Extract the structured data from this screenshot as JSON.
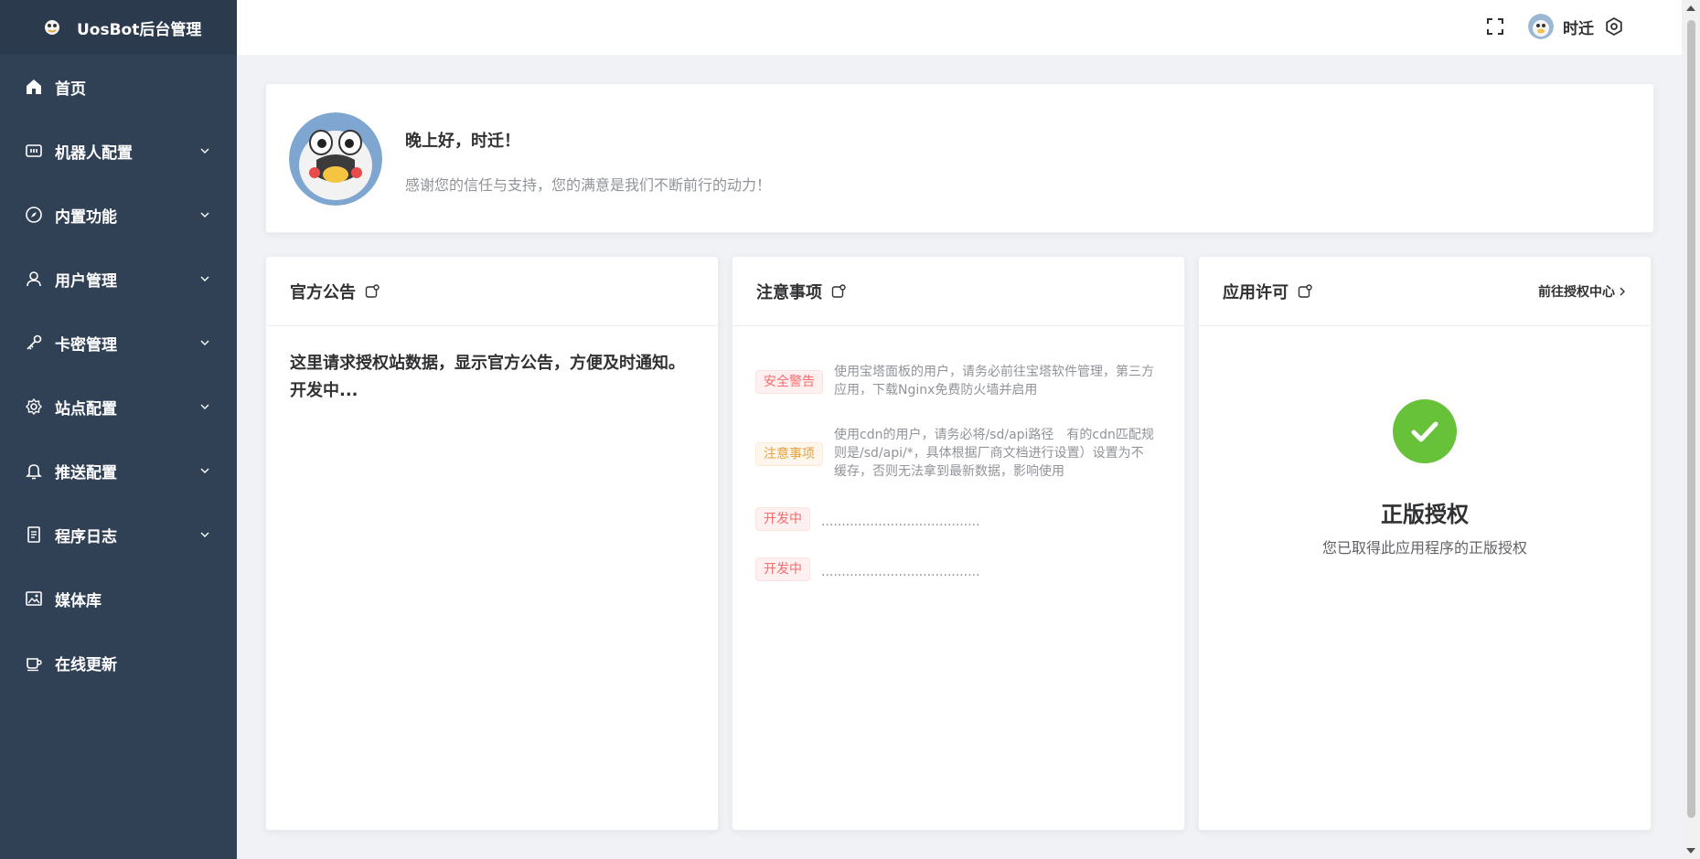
{
  "app": {
    "title": "UosBot后台管理"
  },
  "sidebar": {
    "items": [
      {
        "label": "首页",
        "icon": "home-icon",
        "expandable": false
      },
      {
        "label": "机器人配置",
        "icon": "robot-config-icon",
        "expandable": true
      },
      {
        "label": "内置功能",
        "icon": "compass-icon",
        "expandable": true
      },
      {
        "label": "用户管理",
        "icon": "user-icon",
        "expandable": true
      },
      {
        "label": "卡密管理",
        "icon": "key-icon",
        "expandable": true
      },
      {
        "label": "站点配置",
        "icon": "gear-icon",
        "expandable": true
      },
      {
        "label": "推送配置",
        "icon": "bell-icon",
        "expandable": true
      },
      {
        "label": "程序日志",
        "icon": "document-icon",
        "expandable": true
      },
      {
        "label": "媒体库",
        "icon": "image-icon",
        "expandable": false
      },
      {
        "label": "在线更新",
        "icon": "cup-icon",
        "expandable": false
      }
    ]
  },
  "header": {
    "user_name": "时迁"
  },
  "welcome": {
    "greeting": "晚上好，时迁！",
    "message": "感谢您的信任与支持，您的满意是我们不断前行的动力！"
  },
  "announcement": {
    "title": "官方公告",
    "body": "这里请求授权站数据，显示官方公告，方便及时通知。开发中..."
  },
  "notes": {
    "title": "注意事项",
    "items": [
      {
        "tag": "安全警告",
        "type": "danger",
        "text": "使用宝塔面板的用户，请务必前往宝塔软件管理，第三方应用，下载Nginx免费防火墙并启用"
      },
      {
        "tag": "注意事项",
        "type": "warning",
        "text": "使用cdn的用户，请务必将/sd/api路径　有的cdn匹配规则是/sd/api/*，具体根据厂商文档进行设置）设置为不缓存，否则无法拿到最新数据，影响使用"
      },
      {
        "tag": "开发中",
        "type": "danger",
        "text": "......................................."
      },
      {
        "tag": "开发中",
        "type": "danger",
        "text": "......................................."
      }
    ]
  },
  "license": {
    "title": "应用许可",
    "link": "前往授权中心",
    "status_title": "正版授权",
    "status_desc": "您已取得此应用程序的正版授权"
  }
}
